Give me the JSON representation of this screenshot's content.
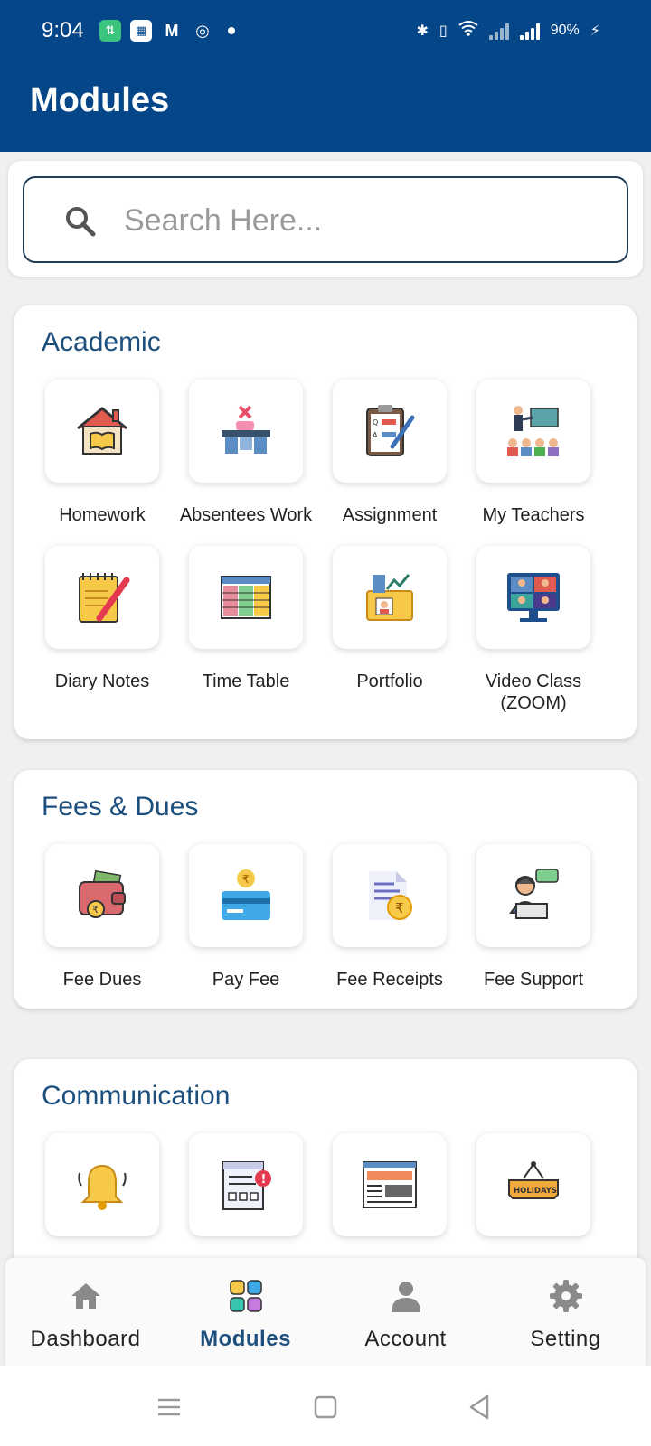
{
  "status_bar": {
    "time": "9:04",
    "battery": "90%"
  },
  "app_bar": {
    "title": "Modules"
  },
  "search": {
    "placeholder": "Search Here...",
    "value": ""
  },
  "sections": [
    {
      "title": "Academic",
      "items": [
        {
          "label": "Homework",
          "icon": "homework-icon"
        },
        {
          "label": "Absentees Work",
          "icon": "absentees-work-icon"
        },
        {
          "label": "Assignment",
          "icon": "assignment-icon"
        },
        {
          "label": "My Teachers",
          "icon": "teachers-icon"
        },
        {
          "label": "Diary Notes",
          "icon": "diary-notes-icon"
        },
        {
          "label": "Time Table",
          "icon": "time-table-icon"
        },
        {
          "label": "Portfolio",
          "icon": "portfolio-icon"
        },
        {
          "label": "Video Class (ZOOM)",
          "icon": "video-class-icon"
        }
      ]
    },
    {
      "title": "Fees & Dues",
      "items": [
        {
          "label": "Fee Dues",
          "icon": "fee-dues-icon"
        },
        {
          "label": "Pay Fee",
          "icon": "pay-fee-icon"
        },
        {
          "label": "Fee Receipts",
          "icon": "fee-receipts-icon"
        },
        {
          "label": "Fee Support",
          "icon": "fee-support-icon"
        }
      ]
    },
    {
      "title": "Communication",
      "items": [
        {
          "label": "",
          "icon": "notification-bell-icon"
        },
        {
          "label": "",
          "icon": "notice-board-icon"
        },
        {
          "label": "",
          "icon": "news-icon"
        },
        {
          "label": "",
          "icon": "holidays-icon",
          "icon_text": "HOLIDAYS"
        }
      ]
    }
  ],
  "bottom_nav": [
    {
      "label": "Dashboard",
      "icon": "home-icon",
      "active": false
    },
    {
      "label": "Modules",
      "icon": "modules-icon",
      "active": true
    },
    {
      "label": "Account",
      "icon": "account-icon",
      "active": false
    },
    {
      "label": "Setting",
      "icon": "gear-icon",
      "active": false
    }
  ],
  "colors": {
    "primary": "#044688",
    "section_title": "#1c4f7d",
    "background": "#f0f0f0"
  }
}
